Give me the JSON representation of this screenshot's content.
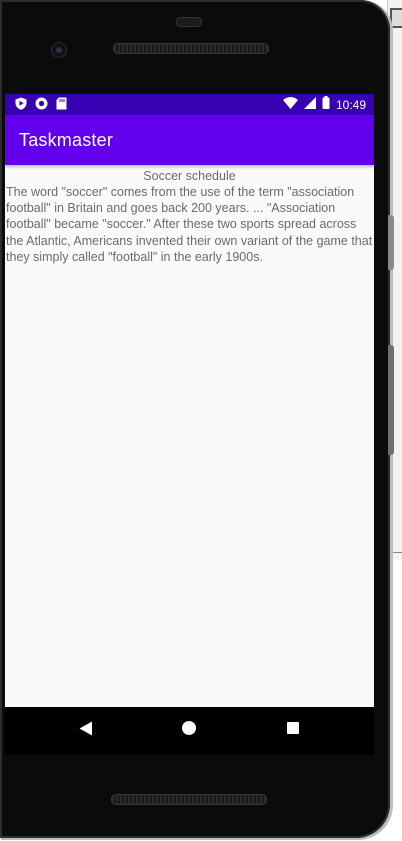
{
  "status_bar": {
    "time": "10:49",
    "left_icons": [
      "play-protect-icon",
      "record-icon",
      "sd-card-icon"
    ],
    "right_icons": [
      "wifi-icon",
      "signal-icon",
      "battery-icon"
    ],
    "color": "#3700b3"
  },
  "app_bar": {
    "title": "Taskmaster",
    "color": "#6200ee"
  },
  "task": {
    "title": "Soccer schedule",
    "body": "The word \"soccer\" comes from the use of the term \"association football\" in Britain and goes back 200 years. ... \"Association football\" became \"soccer.\" After these two sports spread across the Atlantic, Americans invented their own variant of the game that they simply called \"football\" in the early 1900s."
  },
  "nav_bar": {
    "buttons": [
      "back-icon",
      "home-icon",
      "recents-icon"
    ]
  }
}
